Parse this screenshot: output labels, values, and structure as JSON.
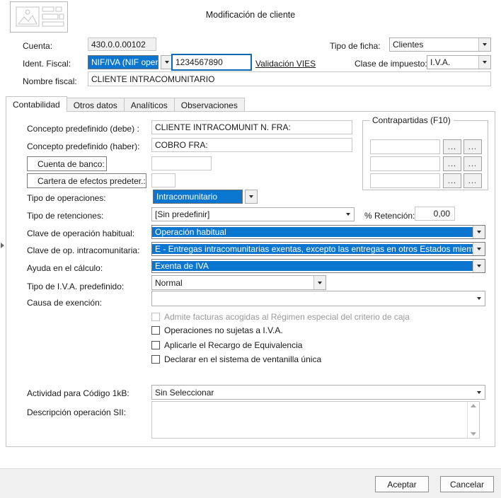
{
  "window": {
    "title": "Modificación de cliente",
    "icon": "form-image-placeholder-icon"
  },
  "header_form": {
    "cuenta_label": "Cuenta:",
    "cuenta_value": "430.0.0.00102",
    "ident_fiscal_label": "Ident. Fiscal:",
    "ident_fiscal_value": "NIF/IVA (NIF operad",
    "nif_value": "1234567890",
    "validacion_vies_link": "Validación VIES",
    "nombre_fiscal_label": "Nombre fiscal:",
    "nombre_fiscal_value": "CLIENTE INTRACOMUNITARIO",
    "tipo_ficha_label": "Tipo de ficha:",
    "tipo_ficha_value": "Clientes",
    "clase_impuesto_label": "Clase de impuesto:",
    "clase_impuesto_value": "I.V.A."
  },
  "tabs": [
    {
      "label": "Contabilidad",
      "active": true
    },
    {
      "label": "Otros datos",
      "active": false
    },
    {
      "label": "Analíticos",
      "active": false
    },
    {
      "label": "Observaciones",
      "active": false
    }
  ],
  "contabilidad": {
    "concepto_debe_label": "Concepto predefinido (debe) :",
    "concepto_debe_value": "CLIENTE INTRACOMUNIT N. FRA:",
    "concepto_haber_label": "Concepto predefinido (haber):",
    "concepto_haber_value": "COBRO FRA:",
    "cuenta_banco_label": "Cuenta de banco:",
    "cuenta_banco_value": "",
    "cartera_efectos_label": "Cartera de efectos predeter.:",
    "cartera_efectos_value": "",
    "tipo_operaciones_label": "Tipo de operaciones:",
    "tipo_operaciones_value": "Intracomunitario",
    "tipo_retenciones_label": "Tipo de retenciones:",
    "tipo_retenciones_value": "[Sin predefinir]",
    "pct_retencion_label": "% Retención:",
    "pct_retencion_value": "0,00",
    "clave_operacion_label": "Clave de operación habitual:",
    "clave_operacion_value": "Operación habitual",
    "clave_intracom_label": "Clave de op. intracomunitaria:",
    "clave_intracom_value": "E - Entregas intracomunitarias exentas, excepto las entregas en otros Estados miembro",
    "ayuda_calculo_label": "Ayuda en el cálculo:",
    "ayuda_calculo_value": "Exenta de IVA",
    "tipo_iva_label": "Tipo de I.V.A. predefinido:",
    "tipo_iva_value": "Normal",
    "causa_exencion_label": "Causa de exención:",
    "causa_exencion_value": "",
    "actividad_label": "Actividad para Código 1kB:",
    "actividad_value": "Sin Seleccionar",
    "descripcion_sii_label": "Descripción operación SII:",
    "descripcion_sii_value": ""
  },
  "checkboxes": [
    {
      "label": "Admite facturas acogidas al Régimen especial del criterio de caja",
      "checked": false,
      "disabled": true
    },
    {
      "label": "Operaciones no sujetas a I.V.A.",
      "checked": false,
      "disabled": false
    },
    {
      "label": "Aplicarle el Recargo de Equivalencia",
      "checked": false,
      "disabled": false
    },
    {
      "label": "Declarar en el sistema de ventanilla única",
      "checked": false,
      "disabled": false
    }
  ],
  "contrapartidas": {
    "legend": "Contrapartidas (F10)",
    "rows": [
      {
        "value": "",
        "btn1": "...",
        "btn2": "..."
      },
      {
        "value": "",
        "btn1": "...",
        "btn2": "..."
      },
      {
        "value": "",
        "btn1": "...",
        "btn2": "..."
      }
    ]
  },
  "footer": {
    "accept_label": "Aceptar",
    "cancel_label": "Cancelar"
  },
  "colors": {
    "selection_blue": "#0b76d0",
    "focus_border": "#0d6ab0",
    "panel_bg": "#ffffff",
    "footer_bg": "#f0f0f0"
  }
}
